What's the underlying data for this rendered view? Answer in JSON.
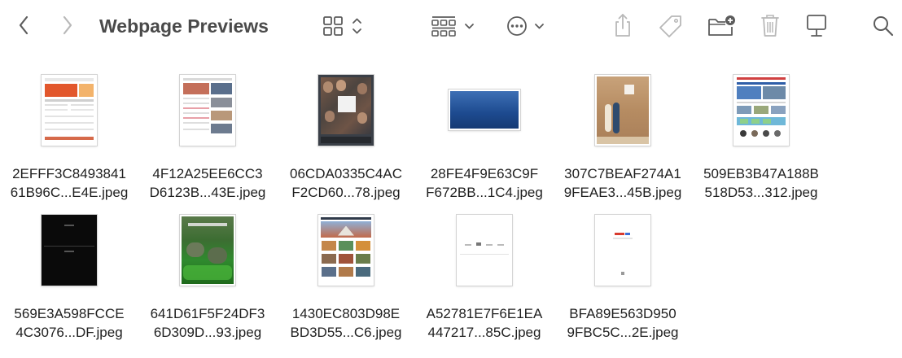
{
  "window": {
    "title": "Webpage Previews"
  },
  "toolbar": {
    "back_icon": "chevron-left-icon",
    "forward_icon": "chevron-right-icon",
    "view_icon": "grid-view-icon",
    "group_icon": "group-by-icon",
    "more_icon": "ellipsis-circle-icon",
    "share_icon": "share-icon",
    "tag_icon": "tag-icon",
    "new_folder_icon": "new-folder-icon",
    "trash_icon": "trash-icon",
    "connect_icon": "connect-display-icon",
    "search_icon": "search-icon"
  },
  "files": [
    {
      "line1": "2EFFF3C8493841",
      "line2": "61B96C...E4E.jpeg",
      "thumb": "portrait-orange"
    },
    {
      "line1": "4F12A25EE6CC3",
      "line2": "D6123B...43E.jpeg",
      "thumb": "portrait-article"
    },
    {
      "line1": "06CDA0335C4AC",
      "line2": "F2CD60...78.jpeg",
      "thumb": "portrait-dark-people"
    },
    {
      "line1": "28FE4F9E63C9F",
      "line2": "F672BB...1C4.jpeg",
      "thumb": "landscape-blue"
    },
    {
      "line1": "307C7BEAF274A1",
      "line2": "9FEAE3...45B.jpeg",
      "thumb": "portrait-couple"
    },
    {
      "line1": "509EB3B47A188B",
      "line2": "518D53...312.jpeg",
      "thumb": "portrait-travel"
    },
    {
      "line1": "569E3A598FCCE",
      "line2": "4C3076...DF.jpeg",
      "thumb": "portrait-black"
    },
    {
      "line1": "641D61F5F24DF3",
      "line2": "6D309D...93.jpeg",
      "thumb": "portrait-nature"
    },
    {
      "line1": "1430EC803D98E",
      "line2": "BD3D55...C6.jpeg",
      "thumb": "portrait-gallery"
    },
    {
      "line1": "A52781E7F6E1EA",
      "line2": "447217...85C.jpeg",
      "thumb": "portrait-blank"
    },
    {
      "line1": "BFA89E563D950",
      "line2": "9FBC5C...2E.jpeg",
      "thumb": "portrait-minimal"
    }
  ],
  "colors": {
    "icon": "#5c5c5c",
    "icon_disabled": "#b8b8b8",
    "title": "#4a4a4a"
  }
}
